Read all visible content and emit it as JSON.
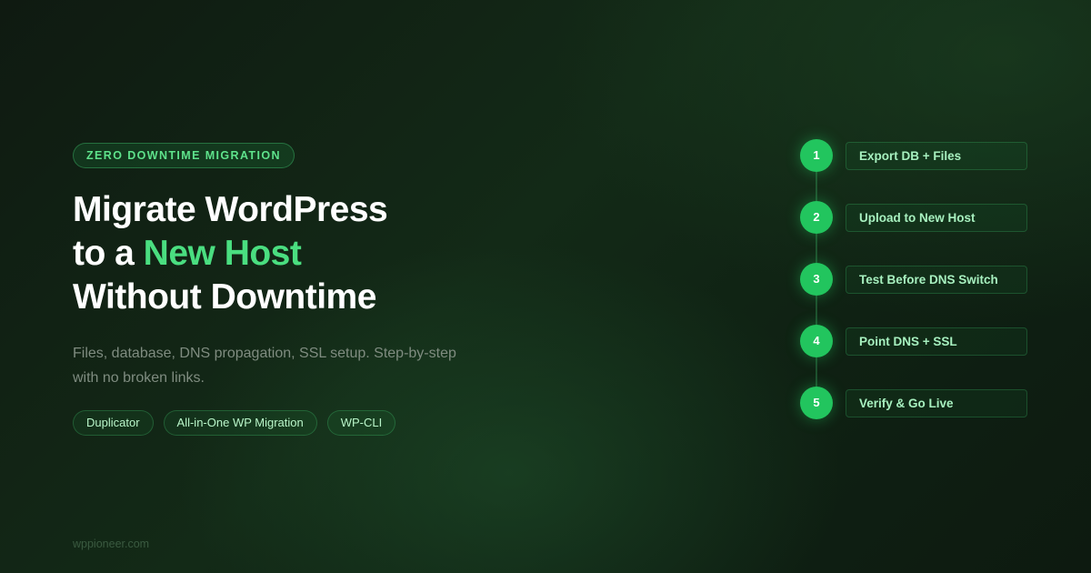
{
  "badge": "ZERO DOWNTIME MIGRATION",
  "headline": {
    "line1": "Migrate WordPress",
    "line2_prefix": "to a ",
    "line2_accent": "New Host",
    "line3": "Without Downtime"
  },
  "description": "Files, database, DNS propagation, SSL setup. Step-by-step with no broken links.",
  "tags": [
    "Duplicator",
    "All-in-One WP Migration",
    "WP-CLI"
  ],
  "steps": [
    {
      "number": "1",
      "label": "Export DB + Files"
    },
    {
      "number": "2",
      "label": "Upload to New Host"
    },
    {
      "number": "3",
      "label": "Test Before DNS Switch"
    },
    {
      "number": "4",
      "label": "Point DNS + SSL"
    },
    {
      "number": "5",
      "label": "Verify & Go Live"
    }
  ],
  "footer": "wppioneer.com",
  "colors": {
    "accent": "#4ade80",
    "step_circle": "#22c55e",
    "background": "#132a17"
  }
}
